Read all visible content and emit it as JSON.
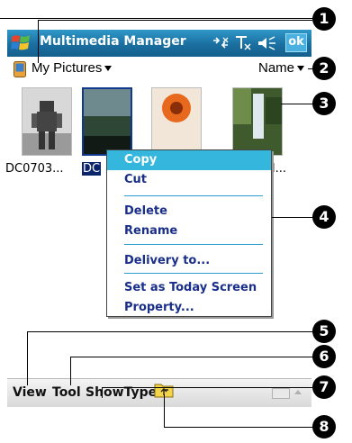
{
  "titlebar": {
    "app_title": "Multimedia Manager",
    "ok_label": "ok"
  },
  "folderbar": {
    "folder": "My Pictures",
    "sort": "Name"
  },
  "thumbnails": [
    {
      "label": "DC0703..."
    },
    {
      "label": "DC"
    },
    {
      "label": ""
    },
    {
      "label": "l..."
    }
  ],
  "menu": {
    "items": [
      {
        "label": "Copy"
      },
      {
        "label": "Cut"
      },
      {
        "label": "Delete"
      },
      {
        "label": "Rename"
      },
      {
        "label": "Delivery to..."
      },
      {
        "label": "Set as Today Screen"
      },
      {
        "label": "Property..."
      }
    ]
  },
  "callouts": [
    "1",
    "2",
    "3",
    "4",
    "5",
    "6",
    "7",
    "8"
  ],
  "bottombar": {
    "view": "View",
    "tool": "Tool",
    "showtype": "ShowType"
  },
  "colors": {
    "titlebar": "#1a6fa0",
    "menu_highlight": "#35b6dc",
    "menu_text": "#1a2f8a",
    "selection": "#0a246a"
  }
}
